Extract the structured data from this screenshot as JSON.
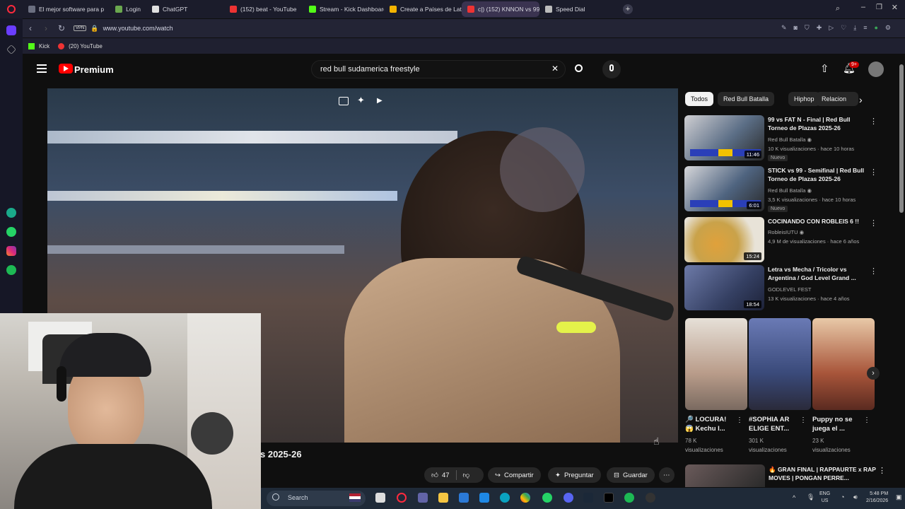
{
  "browser": {
    "tabs": [
      {
        "label": "El mejor software para p",
        "color": "#6b6f80"
      },
      {
        "label": "Login",
        "color": "#6aa84f"
      },
      {
        "label": "ChatGPT",
        "color": "#e0e0e0"
      },
      {
        "label": "(152) beat - YouTube",
        "color": "#e33"
      },
      {
        "label": "Stream - Kick Dashboard",
        "color": "#53fc18"
      },
      {
        "label": "Create a Países de Latino",
        "color": "#f4b400"
      },
      {
        "label": "c|) (152) KNNON vs 99 ·",
        "color": "#e33"
      },
      {
        "label": "Speed Dial",
        "color": "#bbb"
      }
    ],
    "url": "www.youtube.com/watch",
    "vpn": "VPN",
    "bookmarks": [
      {
        "label": "Kick",
        "color": "#53fc18"
      },
      {
        "label": "(20) YouTube",
        "color": "#e33"
      }
    ]
  },
  "youtube": {
    "logo": "Premium",
    "search_query": "red bull sudamerica freestyle",
    "notification_count": "9+",
    "video_title_partial": "s 2025-26",
    "actions": {
      "likes": "47",
      "share": "Compartir",
      "ask": "Preguntar",
      "save": "Guardar"
    },
    "chips": [
      "Todos",
      "Red Bull Batalla",
      "Hiphop",
      "Relacion"
    ],
    "recommendations": [
      {
        "title": "99 vs FAT N - Final | Red Bull Torneo de Plazas 2025-26",
        "channel": "Red Bull Batalla",
        "meta": "10 K visualizaciones · hace 10 horas",
        "badge": "Nuevo",
        "duration": "11:46",
        "thumb_color": "#5b6e86"
      },
      {
        "title": "STICK vs 99 - Semifinal | Red Bull Torneo de Plazas 2025-26",
        "channel": "Red Bull Batalla",
        "meta": "3,5 K visualizaciones · hace 10 horas",
        "badge": "Nuevo",
        "duration": "6:01",
        "thumb_color": "#4f6480"
      },
      {
        "title": "COCINANDO CON ROBLEIS 6 !!",
        "channel": "RobleisIUTU",
        "meta": "4,9 M de visualizaciones · hace 6 años",
        "badge": "",
        "duration": "15:24",
        "thumb_color": "#c9a24a"
      },
      {
        "title": "Letra vs Mecha / Tricolor vs Argentina / God Level Grand ...",
        "channel": "GODLEVEL FEST",
        "meta": "13 K visualizaciones · hace 4 años",
        "badge": "",
        "duration": "18:54",
        "thumb_color": "#354063"
      }
    ],
    "shorts": [
      {
        "title": "🔎 LOCURA! 😱 Kechu l...",
        "views": "78 K",
        "views_label": "visualizaciones",
        "color": "#b99c8a"
      },
      {
        "title": "#SOPHIA AR ELIGE ENT...",
        "views": "301 K",
        "views_label": "visualizaciones",
        "color": "#3a4a7a"
      },
      {
        "title": "Puppy no se juega el ...",
        "views": "23 K",
        "views_label": "visualizaciones",
        "color": "#a8553a"
      }
    ],
    "next_rec_title": "🔥 GRAN FINAL | RAPPAURTE x RAP MOVES | PONGAN PERRE..."
  },
  "taskbar": {
    "search_placeholder": "Search",
    "language": "ENG",
    "region": "US",
    "time": "5:48 PM",
    "date": "2/16/2026"
  }
}
